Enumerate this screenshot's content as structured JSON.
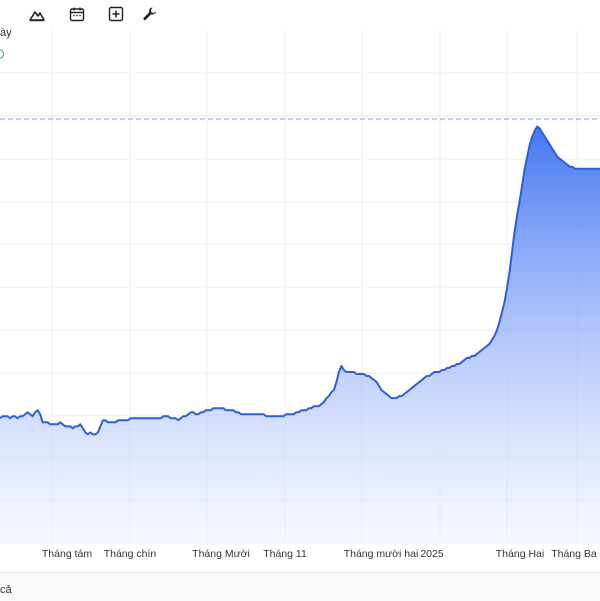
{
  "toolbar": {
    "icons": [
      "mountain-chart-icon",
      "calendar-icon",
      "plus-box-icon",
      "wrench-icon"
    ]
  },
  "header": {
    "ticker_fragment": "ày"
  },
  "footer": {
    "text_fragment": "cả"
  },
  "colors": {
    "line": "#2f5fd6",
    "fill_top": "#3b6ff2",
    "fill_bottom": "#eef3ff",
    "grid": "#ececf2",
    "ref_line": "#8a9fd6"
  },
  "chart_data": {
    "type": "area",
    "x_tick_labels": [
      "Tháng tám",
      "Tháng chín",
      "Tháng Mười",
      "Tháng 11",
      "Tháng mười hai",
      "2025",
      "Tháng Hai",
      "Tháng Ba"
    ],
    "grid": true,
    "reference_line": "dashed horizontal",
    "series": [
      {
        "values": [
          0.62,
          0.63,
          0.63,
          0.63,
          0.62,
          0.63,
          0.63,
          0.62,
          0.63,
          0.63,
          0.64,
          0.65,
          0.64,
          0.63,
          0.65,
          0.66,
          0.64,
          0.6,
          0.6,
          0.6,
          0.59,
          0.59,
          0.59,
          0.59,
          0.6,
          0.59,
          0.58,
          0.58,
          0.58,
          0.57,
          0.58,
          0.58,
          0.59,
          0.57,
          0.55,
          0.54,
          0.55,
          0.54,
          0.54,
          0.55,
          0.58,
          0.61,
          0.61,
          0.6,
          0.6,
          0.6,
          0.6,
          0.61,
          0.61,
          0.61,
          0.61,
          0.61,
          0.62,
          0.62,
          0.62,
          0.62,
          0.62,
          0.62,
          0.62,
          0.62,
          0.62,
          0.62,
          0.62,
          0.62,
          0.62,
          0.63,
          0.63,
          0.63,
          0.62,
          0.62,
          0.62,
          0.61,
          0.62,
          0.63,
          0.63,
          0.64,
          0.65,
          0.65,
          0.64,
          0.64,
          0.65,
          0.65,
          0.66,
          0.66,
          0.66,
          0.67,
          0.67,
          0.67,
          0.67,
          0.67,
          0.66,
          0.66,
          0.66,
          0.66,
          0.65,
          0.65,
          0.64,
          0.64,
          0.64,
          0.64,
          0.64,
          0.64,
          0.64,
          0.64,
          0.64,
          0.64,
          0.63,
          0.63,
          0.63,
          0.63,
          0.63,
          0.63,
          0.63,
          0.63,
          0.64,
          0.64,
          0.64,
          0.64,
          0.65,
          0.65,
          0.66,
          0.66,
          0.66,
          0.67,
          0.67,
          0.68,
          0.68,
          0.68,
          0.69,
          0.7,
          0.72,
          0.73,
          0.75,
          0.76,
          0.8,
          0.85,
          0.88,
          0.86,
          0.85,
          0.85,
          0.85,
          0.85,
          0.84,
          0.84,
          0.84,
          0.84,
          0.83,
          0.83,
          0.82,
          0.81,
          0.8,
          0.78,
          0.76,
          0.75,
          0.74,
          0.73,
          0.72,
          0.72,
          0.72,
          0.73,
          0.73,
          0.74,
          0.75,
          0.76,
          0.77,
          0.78,
          0.79,
          0.8,
          0.81,
          0.82,
          0.83,
          0.83,
          0.84,
          0.85,
          0.85,
          0.85,
          0.86,
          0.86,
          0.87,
          0.87,
          0.88,
          0.88,
          0.89,
          0.89,
          0.9,
          0.91,
          0.92,
          0.92,
          0.93,
          0.93,
          0.94,
          0.95,
          0.96,
          0.97,
          0.98,
          0.99,
          1.01,
          1.03,
          1.06,
          1.1,
          1.15,
          1.2,
          1.27,
          1.35,
          1.45,
          1.55,
          1.63,
          1.7,
          1.78,
          1.86,
          1.92,
          1.98,
          2.02,
          2.05,
          2.07,
          2.06,
          2.04,
          2.02,
          2.0,
          1.98,
          1.96,
          1.94,
          1.92,
          1.91,
          1.9,
          1.89,
          1.88,
          1.87,
          1.87,
          1.86,
          1.86,
          1.86,
          1.86,
          1.86,
          1.86,
          1.86,
          1.86,
          1.86,
          1.86,
          1.86
        ]
      }
    ]
  }
}
